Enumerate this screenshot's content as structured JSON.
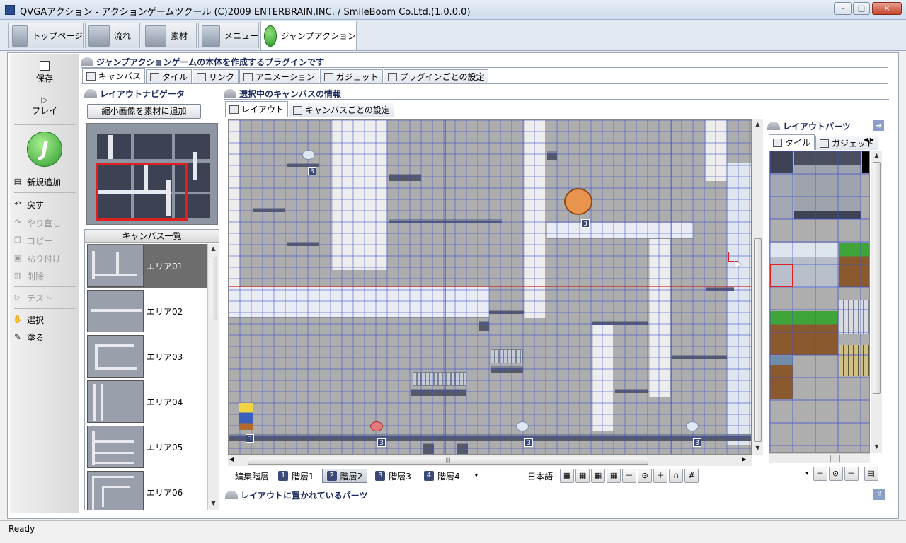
{
  "window": {
    "title": "QVGAアクション - アクションゲームツクール (C)2009 ENTERBRAIN,INC. / SmileBoom Co.Ltd.(1.0.0.0)",
    "min": "–",
    "max": "□",
    "close": "×"
  },
  "top_tabs": [
    {
      "label": "トップページ"
    },
    {
      "label": "流れ"
    },
    {
      "label": "素材"
    },
    {
      "label": "メニュー"
    },
    {
      "label": "ジャンプアクション"
    }
  ],
  "left_toolbar": {
    "save": "保存",
    "play": "プレイ",
    "logo": "J",
    "items": [
      {
        "label": "新規追加",
        "icon": "new-icon",
        "enabled": true
      },
      {
        "label": "戻す",
        "icon": "undo-icon",
        "enabled": true
      },
      {
        "label": "やり直し",
        "icon": "redo-icon",
        "enabled": false
      },
      {
        "label": "コピー",
        "icon": "copy-icon",
        "enabled": false
      },
      {
        "label": "貼り付け",
        "icon": "paste-icon",
        "enabled": false
      },
      {
        "label": "削除",
        "icon": "delete-icon",
        "enabled": false
      },
      {
        "label": "テスト",
        "icon": "test-icon",
        "enabled": false
      },
      {
        "label": "選択",
        "icon": "select-hand-icon",
        "enabled": true
      },
      {
        "label": "塗る",
        "icon": "paint-icon",
        "enabled": true
      }
    ]
  },
  "plugin": {
    "heading": "ジャンプアクションゲームの本体を作成するプラグインです",
    "tabs": [
      "キャンバス",
      "タイル",
      "リンク",
      "アニメーション",
      "ガジェット",
      "プラグインごとの設定"
    ]
  },
  "navigator": {
    "heading": "レイアウトナビゲータ",
    "add_button": "縮小画像を素材に追加"
  },
  "canvas_list": {
    "heading": "キャンバス一覧",
    "items": [
      "エリア01",
      "エリア02",
      "エリア03",
      "エリア04",
      "エリア05",
      "エリア06"
    ],
    "selected": "エリア01"
  },
  "canvas_info": {
    "heading": "選択中のキャンバスの情報",
    "tabs": [
      "レイアウト",
      "キャンバスごとの設定"
    ]
  },
  "stage": {
    "layer_marks": [
      "3",
      "3",
      "3",
      "3",
      "3",
      "3"
    ]
  },
  "layer_bar": {
    "label": "編集階層",
    "layers": [
      {
        "num": "1",
        "label": "階層1"
      },
      {
        "num": "2",
        "label": "階層2"
      },
      {
        "num": "3",
        "label": "階層3"
      },
      {
        "num": "4",
        "label": "階層4"
      }
    ],
    "selected_layer": 2,
    "language": "日本語"
  },
  "parts": {
    "heading": "レイアウトパーツ",
    "tabs": [
      "タイル",
      "ガジェット"
    ]
  },
  "placed_parts": {
    "heading": "レイアウトに置かれているパーツ"
  },
  "status": {
    "text": "Ready"
  },
  "colors": {
    "grid": "#3b4fd0",
    "guide": "#d02020",
    "accent": "#1a2a5a"
  }
}
